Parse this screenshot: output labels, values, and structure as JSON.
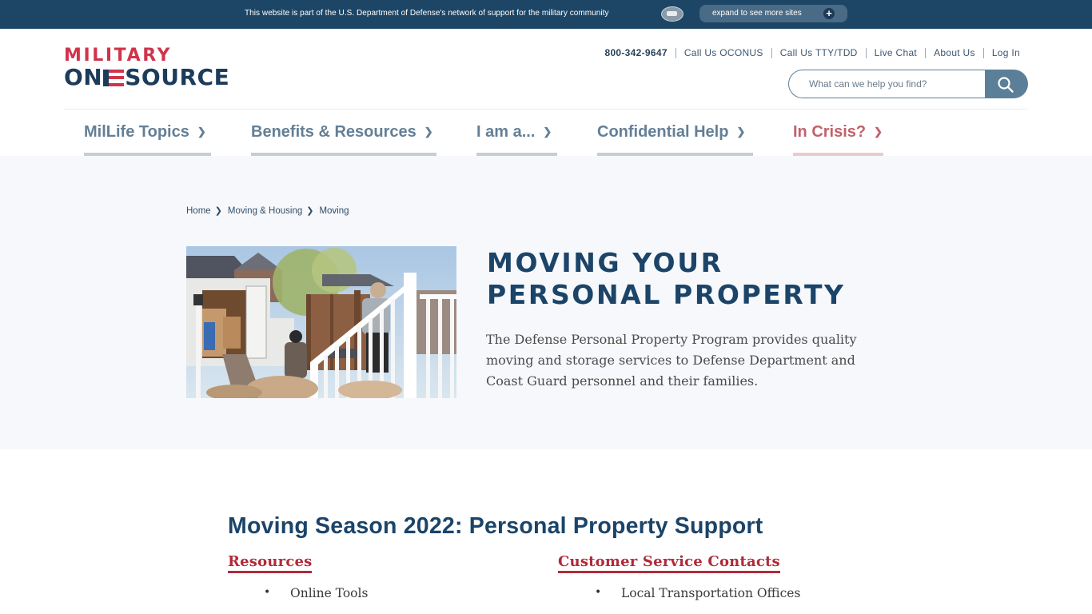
{
  "banner": {
    "message": "This website is part of the U.S. Department of Defense's network of support for the military community",
    "seal_icon": "pentagon-seal-icon",
    "expand_label": "expand to see more sites",
    "expand_icon": "plus-icon",
    "colors": {
      "background": "#1d4666",
      "button": "#4a6b85"
    }
  },
  "logo": {
    "line1": "MILITARY",
    "line2_left": "ON",
    "line2_right": "SOURCE",
    "colors": {
      "red": "#d0344b",
      "navy": "#1b3c5a"
    }
  },
  "utility_links": [
    {
      "label": "800-342-9647",
      "type": "phone"
    },
    {
      "label": "Call Us OCONUS"
    },
    {
      "label": "Call Us TTY/TDD"
    },
    {
      "label": "Live Chat"
    },
    {
      "label": "About Us"
    },
    {
      "label": "Log In"
    }
  ],
  "search": {
    "placeholder": "What can we help you find?",
    "value": "",
    "button_icon": "search-icon"
  },
  "main_nav": [
    {
      "label": "MilLife Topics",
      "icon": "chevron-down-icon"
    },
    {
      "label": "Benefits & Resources",
      "icon": "chevron-down-icon"
    },
    {
      "label": "I am a...",
      "icon": "chevron-down-icon"
    },
    {
      "label": "Confidential Help",
      "icon": "chevron-down-icon"
    },
    {
      "label": "In Crisis?",
      "icon": "chevron-down-icon",
      "accent": "#c0626d"
    }
  ],
  "breadcrumb": [
    {
      "label": "Home"
    },
    {
      "label": "Moving & Housing"
    },
    {
      "label": "Moving"
    }
  ],
  "hero": {
    "image_alt": "Movers loading boxes into a moving truck in front of a house",
    "title_line1": "MOVING YOUR",
    "title_line2": "PERSONAL PROPERTY",
    "description": "The Defense Personal Property Program provides quality moving and storage services to Defense Department and Coast Guard personnel and their families."
  },
  "content": {
    "section_title": "Moving Season 2022: Personal Property Support",
    "columns": [
      {
        "heading": "Resources",
        "items": [
          "Online Tools"
        ]
      },
      {
        "heading": "Customer Service Contacts",
        "items": [
          "Local Transportation Offices"
        ]
      }
    ],
    "colors": {
      "heading": "#1b4468",
      "subheading": "#b02a3a"
    }
  }
}
